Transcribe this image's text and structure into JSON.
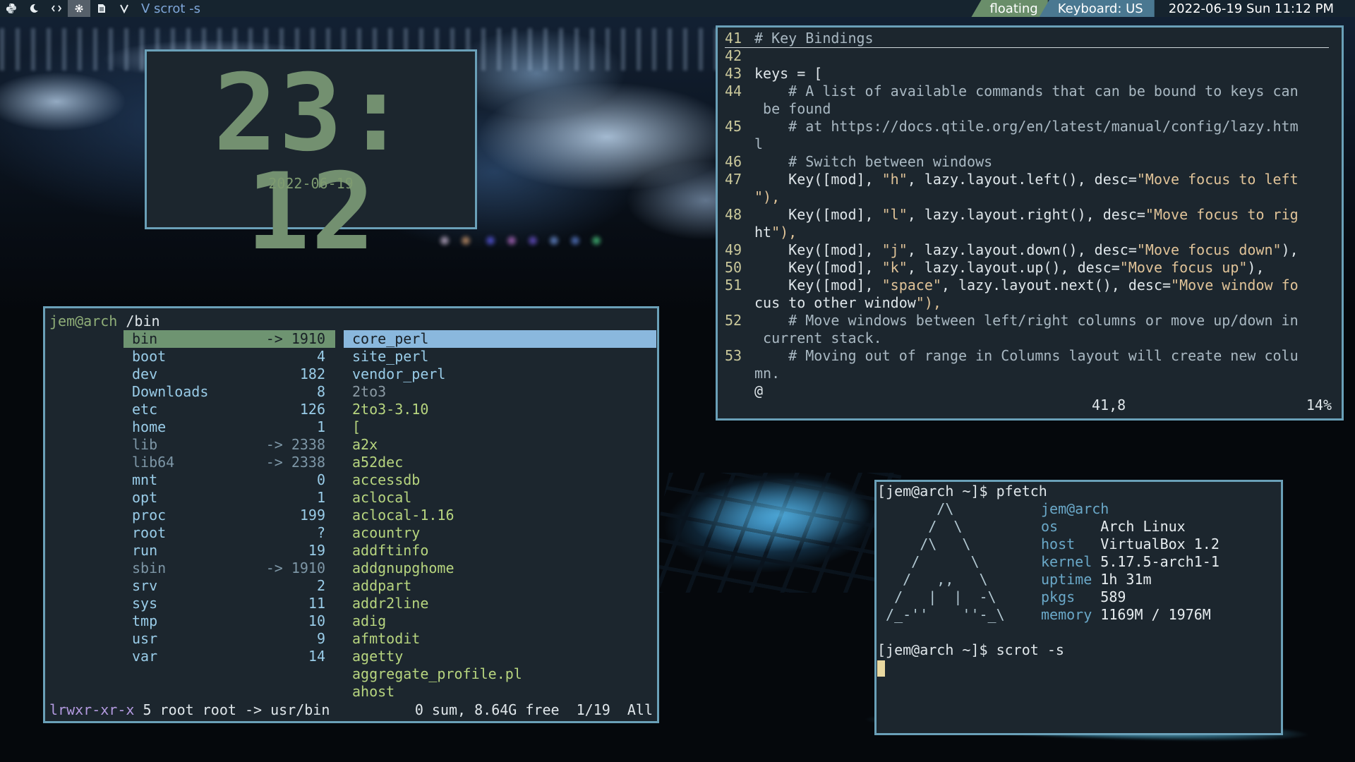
{
  "topbar": {
    "icons": [
      "python-icon",
      "moon-icon",
      "code-icon",
      "gear-icon",
      "document-icon",
      "vim-icon"
    ],
    "active_index": 3,
    "window_title": "V scrot -s",
    "layout": "floating",
    "keyboard": "Keyboard: US",
    "datetime": "2022-06-19 Sun 11:12 PM",
    "colors": {
      "bar_bg": "#16242f",
      "layout_bg": "#6a8e6a",
      "keyboard_bg": "#4a7891"
    }
  },
  "clock": {
    "time": "23: 12",
    "date": "2022-06-19",
    "color": "#739070"
  },
  "file_manager": {
    "user": "jem@arch",
    "path": " /bin",
    "left_pane": [
      {
        "name": "bin",
        "size": "-> 1910",
        "type": "selected"
      },
      {
        "name": "boot",
        "size": "4",
        "type": "dir"
      },
      {
        "name": "dev",
        "size": "182",
        "type": "dir"
      },
      {
        "name": "Downloads",
        "size": "8",
        "type": "dir"
      },
      {
        "name": "etc",
        "size": "126",
        "type": "dir"
      },
      {
        "name": "home",
        "size": "1",
        "type": "dir"
      },
      {
        "name": "lib",
        "size": "-> 2338",
        "type": "link"
      },
      {
        "name": "lib64",
        "size": "-> 2338",
        "type": "link"
      },
      {
        "name": "mnt",
        "size": "0",
        "type": "dir"
      },
      {
        "name": "opt",
        "size": "1",
        "type": "dir"
      },
      {
        "name": "proc",
        "size": "199",
        "type": "dir"
      },
      {
        "name": "root",
        "size": "?",
        "type": "dir"
      },
      {
        "name": "run",
        "size": "19",
        "type": "dir"
      },
      {
        "name": "sbin",
        "size": "-> 1910",
        "type": "link"
      },
      {
        "name": "srv",
        "size": "2",
        "type": "dir"
      },
      {
        "name": "sys",
        "size": "11",
        "type": "dir"
      },
      {
        "name": "tmp",
        "size": "10",
        "type": "dir"
      },
      {
        "name": "usr",
        "size": "9",
        "type": "dir"
      },
      {
        "name": "var",
        "size": "14",
        "type": "dir"
      }
    ],
    "right_pane": [
      {
        "name": "core_perl",
        "type": "selected"
      },
      {
        "name": "site_perl",
        "type": "dir"
      },
      {
        "name": "vendor_perl",
        "type": "dir"
      },
      {
        "name": "2to3",
        "type": "link"
      },
      {
        "name": "2to3-3.10",
        "type": "exec"
      },
      {
        "name": "[",
        "type": "exec"
      },
      {
        "name": "a2x",
        "type": "exec"
      },
      {
        "name": "a52dec",
        "type": "exec"
      },
      {
        "name": "accessdb",
        "type": "exec"
      },
      {
        "name": "aclocal",
        "type": "exec"
      },
      {
        "name": "aclocal-1.16",
        "type": "exec"
      },
      {
        "name": "acountry",
        "type": "exec"
      },
      {
        "name": "addftinfo",
        "type": "exec"
      },
      {
        "name": "addgnupghome",
        "type": "exec"
      },
      {
        "name": "addpart",
        "type": "exec"
      },
      {
        "name": "addr2line",
        "type": "exec"
      },
      {
        "name": "adig",
        "type": "exec"
      },
      {
        "name": "afmtodit",
        "type": "exec"
      },
      {
        "name": "agetty",
        "type": "exec"
      },
      {
        "name": "aggregate_profile.pl",
        "type": "exec"
      },
      {
        "name": "ahost",
        "type": "exec"
      }
    ],
    "status": {
      "permissions": "lrwxr-xr-x",
      "info": " 5 root root -> usr/bin",
      "summary": "0 sum, 8.64G free  1/19  All"
    }
  },
  "vim": {
    "lines": [
      {
        "num": "41",
        "text": "# Key Bindings",
        "kind": "comment"
      },
      {
        "num": "42",
        "text": "",
        "kind": "code"
      },
      {
        "num": "43",
        "text": "keys = [",
        "kind": "code"
      },
      {
        "num": "44",
        "text": "    # A list of available commands that can be bound to keys can",
        "kind": "comment"
      },
      {
        "num": "",
        "text": " be found",
        "kind": "comment"
      },
      {
        "num": "45",
        "text": "    # at https://docs.qtile.org/en/latest/manual/config/lazy.htm",
        "kind": "comment"
      },
      {
        "num": "",
        "text": "l",
        "kind": "comment"
      },
      {
        "num": "46",
        "text": "    # Switch between windows",
        "kind": "comment"
      },
      {
        "num": "47",
        "text": "    Key([mod], \"h\", lazy.layout.left(), desc=\"Move focus to left",
        "kind": "code"
      },
      {
        "num": "",
        "text": "\"),",
        "kind": "code"
      },
      {
        "num": "48",
        "text": "    Key([mod], \"l\", lazy.layout.right(), desc=\"Move focus to rig",
        "kind": "code"
      },
      {
        "num": "",
        "text": "ht\"),",
        "kind": "code"
      },
      {
        "num": "49",
        "text": "    Key([mod], \"j\", lazy.layout.down(), desc=\"Move focus down\"),",
        "kind": "code"
      },
      {
        "num": "50",
        "text": "    Key([mod], \"k\", lazy.layout.up(), desc=\"Move focus up\"),",
        "kind": "code"
      },
      {
        "num": "51",
        "text": "    Key([mod], \"space\", lazy.layout.next(), desc=\"Move window fo",
        "kind": "code"
      },
      {
        "num": "",
        "text": "cus to other window\"),",
        "kind": "code"
      },
      {
        "num": "52",
        "text": "    # Move windows between left/right columns or move up/down in",
        "kind": "comment"
      },
      {
        "num": "",
        "text": " current stack.",
        "kind": "comment"
      },
      {
        "num": "53",
        "text": "    # Moving out of range in Columns layout will create new colu",
        "kind": "comment"
      },
      {
        "num": "",
        "text": "mn.",
        "kind": "comment"
      },
      {
        "num": "",
        "text": "@",
        "kind": "code"
      }
    ],
    "ruler_pos": "41,8",
    "ruler_pct": "14%"
  },
  "terminal": {
    "prompt1": "[jem@arch ~]$ pfetch",
    "logo": [
      "       /\\       ",
      "      /  \\      ",
      "     /\\   \\     ",
      "    /      \\    ",
      "   /   ,,   \\   ",
      "  /   |  |  -\\  ",
      " /_-''    ''-_\\ "
    ],
    "userhost": "jem@arch",
    "info": [
      {
        "key": "os",
        "value": "Arch Linux"
      },
      {
        "key": "host",
        "value": "VirtualBox 1.2"
      },
      {
        "key": "kernel",
        "value": "5.17.5-arch1-1"
      },
      {
        "key": "uptime",
        "value": "1h 31m"
      },
      {
        "key": "pkgs",
        "value": "589"
      },
      {
        "key": "memory",
        "value": "1169M / 1976M"
      }
    ],
    "prompt2": "[jem@arch ~]$ scrot -s"
  }
}
